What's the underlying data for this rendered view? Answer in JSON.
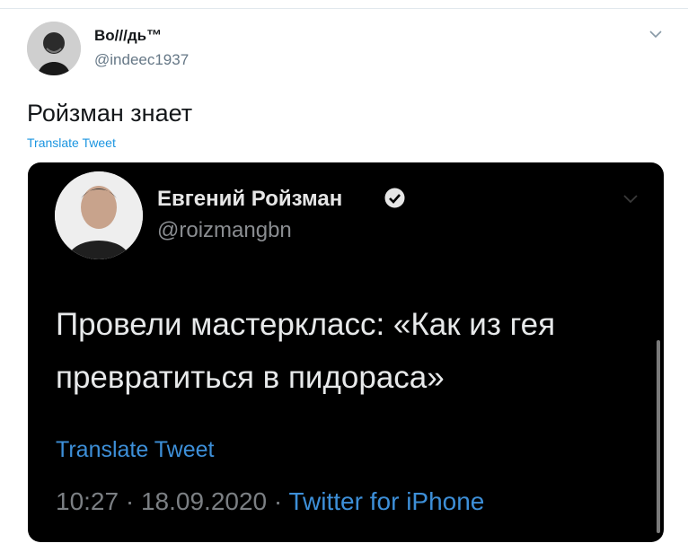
{
  "tweet": {
    "author_name": "Во///дь™",
    "author_handle": "@indeec1937",
    "text": "Ройзман знает",
    "translate_label": "Translate Tweet"
  },
  "embedded_tweet": {
    "author_name": "Евгений Ройзман",
    "author_handle": "@roizmangbn",
    "text": "Провели мастеркласс: «Как из гея превратиться в пидораса»",
    "translate_label": "Translate Tweet",
    "time": "10:27",
    "separator": "·",
    "date": "18.09.2020",
    "source": "Twitter for iPhone"
  },
  "colors": {
    "link": "#1b95e0",
    "embed_background": "#000000"
  }
}
